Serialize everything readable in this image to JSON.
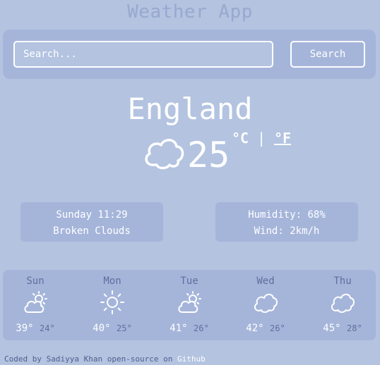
{
  "app": {
    "title": "Weather App"
  },
  "search": {
    "placeholder": "Search...",
    "button_label": "Search"
  },
  "current": {
    "city": "England",
    "temp": "25",
    "unit_c": "°C",
    "unit_separator": "|",
    "unit_f": "°F",
    "icon": "cloud-icon"
  },
  "info": {
    "datetime": "Sunday 11:29",
    "description": "Broken Clouds",
    "humidity": "Humidity: 68%",
    "wind": "Wind: 2km/h"
  },
  "forecast": [
    {
      "day": "Sun",
      "high": "39°",
      "low": "24°",
      "icon": "partly-sunny-icon"
    },
    {
      "day": "Mon",
      "high": "40°",
      "low": "25°",
      "icon": "sun-icon"
    },
    {
      "day": "Tue",
      "high": "41°",
      "low": "26°",
      "icon": "partly-sunny-icon"
    },
    {
      "day": "Wed",
      "high": "42°",
      "low": "26°",
      "icon": "cloud-icon"
    },
    {
      "day": "Thu",
      "high": "45°",
      "low": "28°",
      "icon": "cloud-icon"
    }
  ],
  "footer": {
    "text": "Coded by Sadiyya Khan open-source on",
    "link_label": "Github"
  },
  "colors": {
    "background": "#b3c3e0",
    "panel": "#a5b5da",
    "accent_text": "#5d6f9d",
    "title": "#97a9cf"
  }
}
